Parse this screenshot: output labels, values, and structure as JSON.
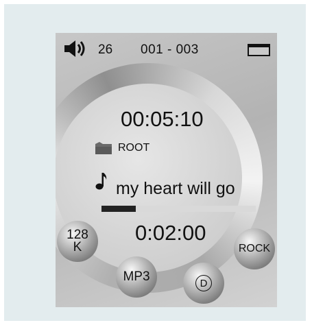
{
  "status_bar": {
    "volume": "26",
    "track_counter": "001 - 003"
  },
  "player": {
    "elapsed_time": "00:05:10",
    "folder": "ROOT",
    "song_title": "my heart will go",
    "progress": 0.22,
    "total_time": "0:02:00"
  },
  "badges": {
    "bitrate_line1": "128",
    "bitrate_line2": "K",
    "format": "MP3",
    "dolby": "D",
    "eq_mode": "ROCK"
  },
  "colors": {
    "frame_bg": "#e3ecee",
    "screen_bg": "#c0c0c0",
    "progress_fill": "#222222",
    "progress_track": "#d9d9d9"
  },
  "icons": [
    "speaker-volume-icon",
    "battery-icon",
    "folder-icon",
    "music-note-icon",
    "dolby-icon"
  ]
}
